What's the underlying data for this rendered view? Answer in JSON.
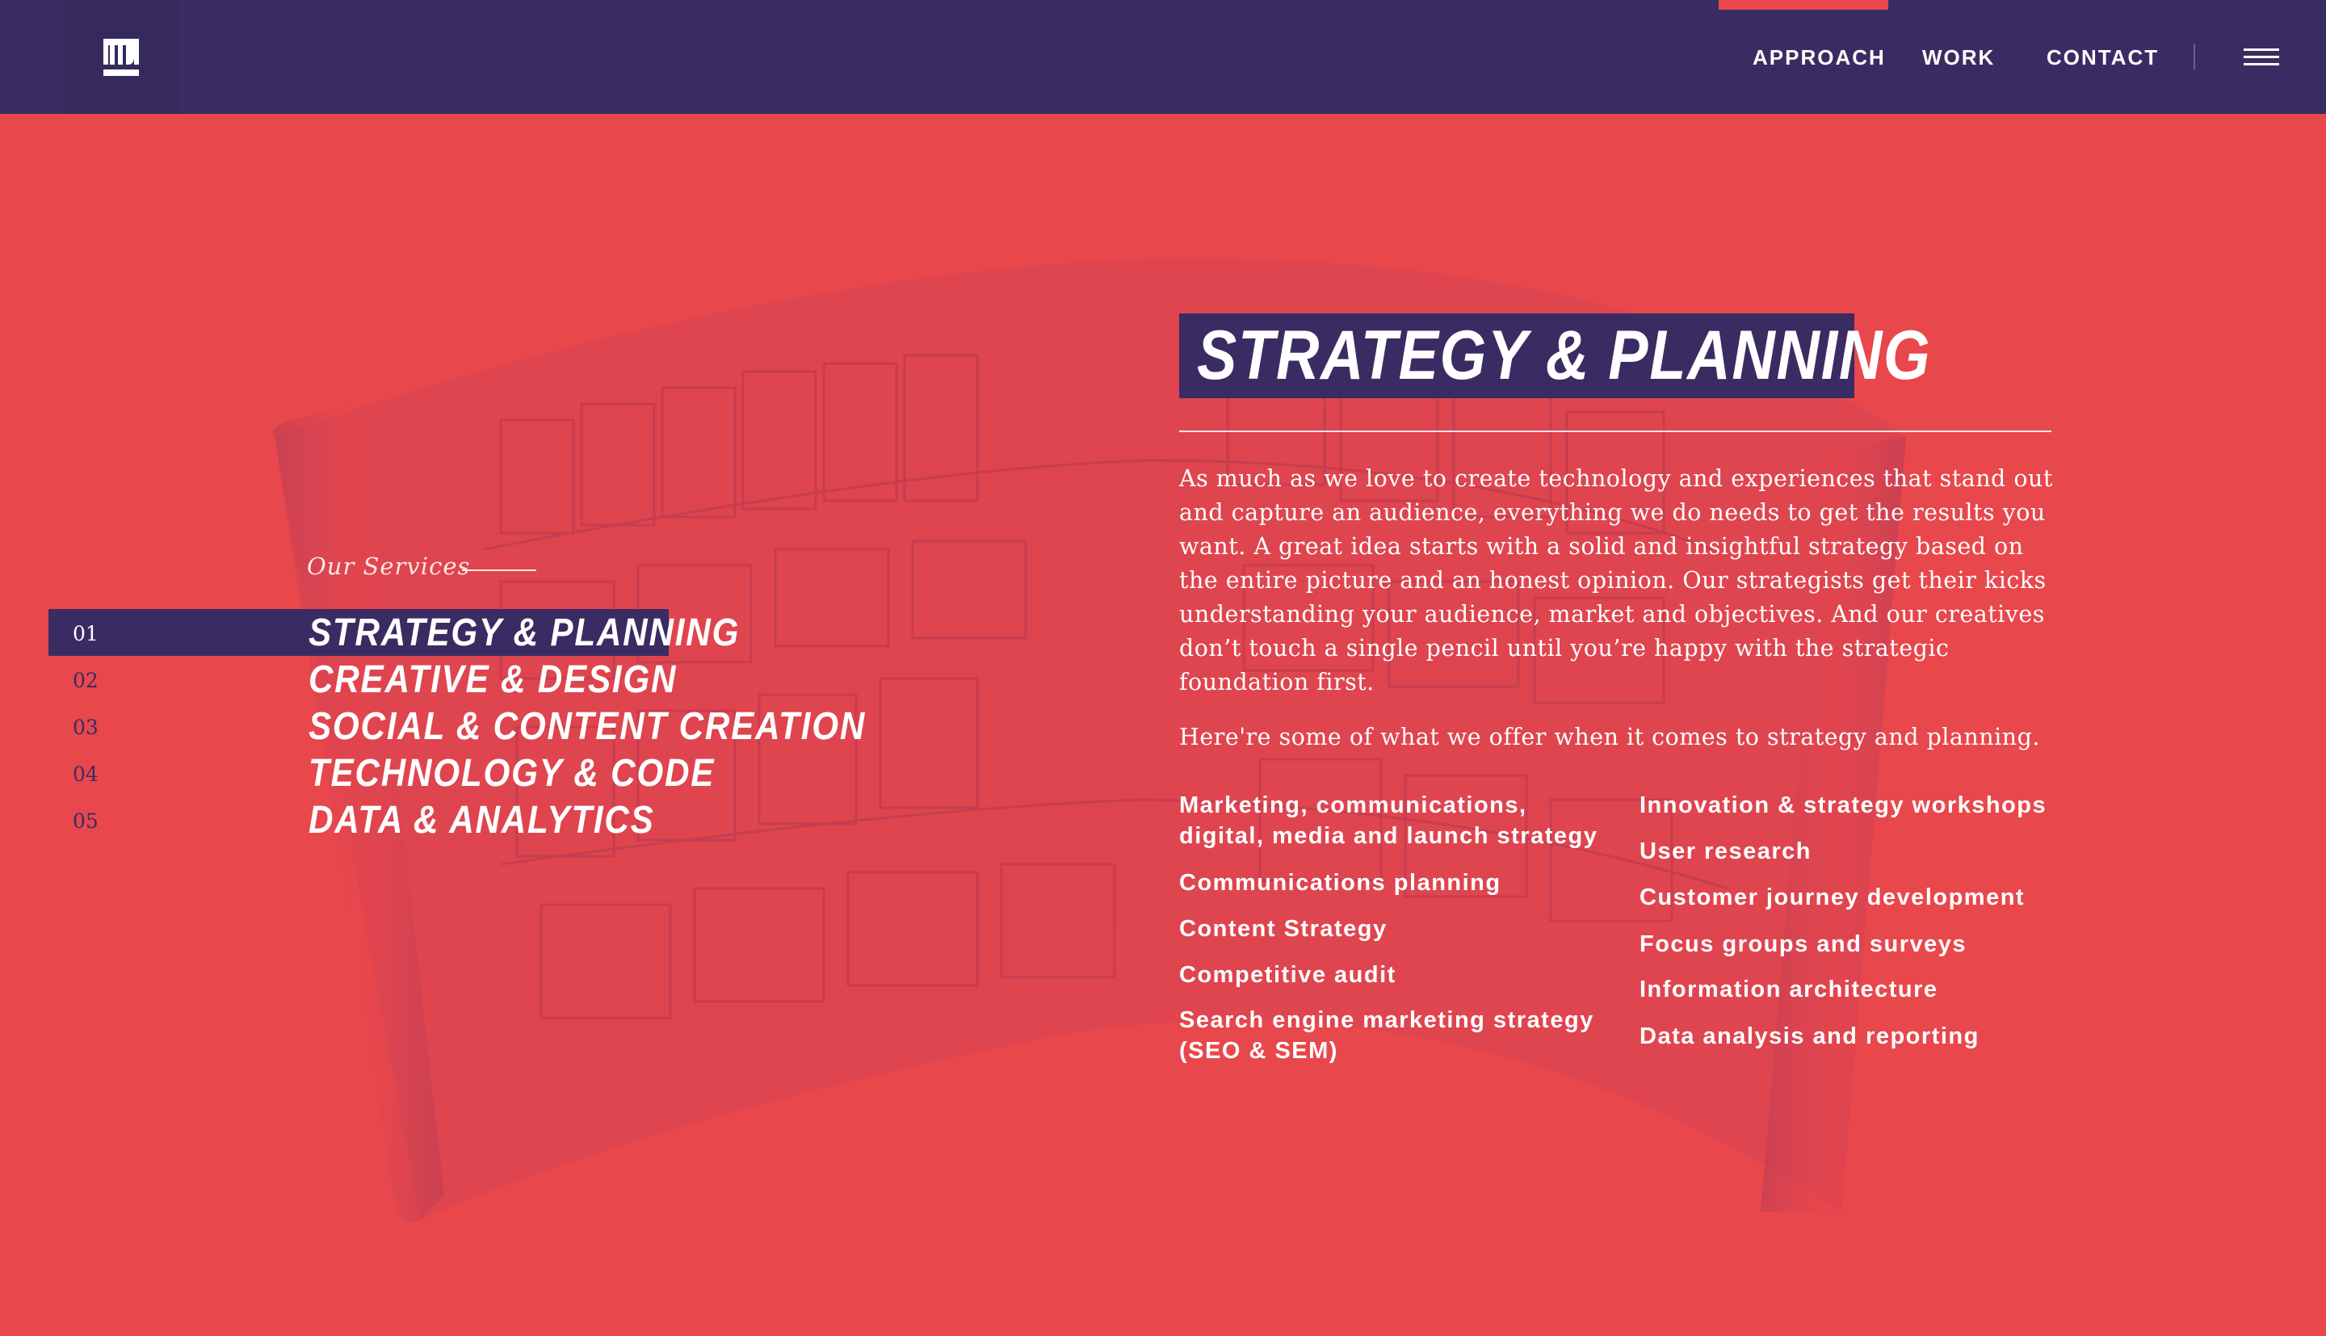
{
  "nav": {
    "links": [
      "APPROACH",
      "WORK",
      "CONTACT"
    ],
    "active": "APPROACH",
    "logo": "logo-icon",
    "menu": "hamburger-icon"
  },
  "services": {
    "label": "Our Services",
    "items": [
      {
        "num": "01",
        "title": "STRATEGY & PLANNING"
      },
      {
        "num": "02",
        "title": "CREATIVE & DESIGN"
      },
      {
        "num": "03",
        "title": "SOCIAL & CONTENT CREATION"
      },
      {
        "num": "04",
        "title": "TECHNOLOGY & CODE"
      },
      {
        "num": "05",
        "title": "DATA & ANALYTICS"
      }
    ],
    "active_index": 0
  },
  "detail": {
    "heading": "STRATEGY & PLANNING",
    "body": "As much as we love to create technology and experiences that stand out and capture an audience, everything we do needs to get the results you want. A great idea starts with a solid and insightful strategy based on the entire picture and an honest opinion. Our strategists get their kicks understanding your audience, market and objectives. And our creatives don’t touch a single pencil until you’re happy with the strategic foundation first.",
    "intro": "Here're some of what we offer when it comes to strategy and planning.",
    "offers_left": [
      "Marketing, communications, digital, media and launch strategy",
      "Communications planning",
      "Content Strategy",
      "Competitive audit",
      "Search engine marketing strategy (SEO & SEM)"
    ],
    "offers_right": [
      "Innovation & strategy workshops",
      "User research",
      "Customer journey development",
      "Focus groups and surveys",
      "Information architecture",
      "Data analysis and reporting"
    ]
  },
  "colors": {
    "background": "#e8474c",
    "navy": "#3a2c63",
    "white": "#ffffff"
  }
}
